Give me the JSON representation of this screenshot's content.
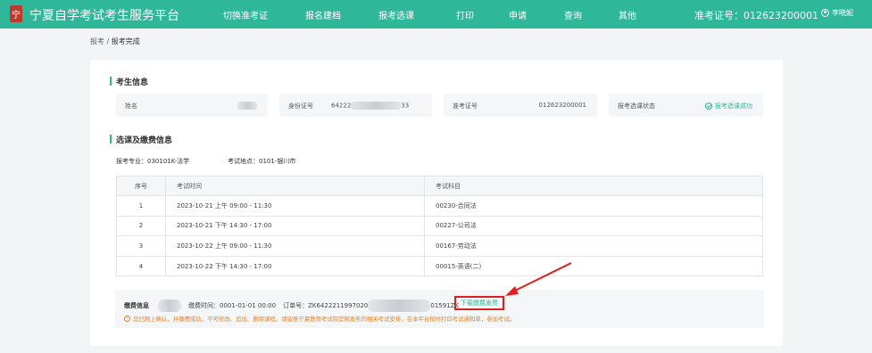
{
  "header": {
    "logo_glyph": "宁",
    "title": "宁夏自学考试考生服务平台",
    "nav": [
      "切换准考证",
      "报名建档",
      "报考选课",
      "打印",
      "申请",
      "查询",
      "其他"
    ],
    "ticket_label": "准考证号：012623200001",
    "user_name": "李晓妮"
  },
  "breadcrumb": {
    "parent": "报考",
    "sep": "/",
    "current": "报考完成"
  },
  "candidate": {
    "section_title": "考生信息",
    "name_label": "姓名",
    "id_label": "身份证号",
    "id_prefix": "64222",
    "id_suffix": "33",
    "ticket_label": "准考证号",
    "ticket_value": "012623200001",
    "status_label": "报考选课状态",
    "status_value": "报考选课成功"
  },
  "selection": {
    "section_title": "选课及缴费信息",
    "major": "报考专业：030101K-法学",
    "location": "考试地点：0101-银川市",
    "columns": [
      "序号",
      "考试时间",
      "考试科目"
    ],
    "rows": [
      [
        "1",
        "2023-10-21 上午 09:00 - 11:30",
        "00230-合同法"
      ],
      [
        "2",
        "2023-10-21 下午 14:30 - 17:00",
        "00227-公司法"
      ],
      [
        "3",
        "2023-10-22 上午 09:00 - 11:30",
        "00167-劳动法"
      ],
      [
        "4",
        "2023-10-22 下午 14:30 - 17:00",
        "00015-英语(二)"
      ]
    ]
  },
  "payment": {
    "label": "缴费信息",
    "pay_time": "缴费时间：0001-01-01 00:00",
    "order_prefix": "订单号：ZK6422211997020",
    "order_suffix": "01591ZK",
    "download_label": "下载缴费发票",
    "notice": "您已网上确认，并缴费成功，不可修改、追加、删除课程。请留意宁夏教育考试院官网发布的相关考试安排，在本平台按时打印考试通知单，参加考试。"
  },
  "colors": {
    "accent": "#2fb79a",
    "highlight": "#e02020",
    "warning": "#e6822a"
  }
}
